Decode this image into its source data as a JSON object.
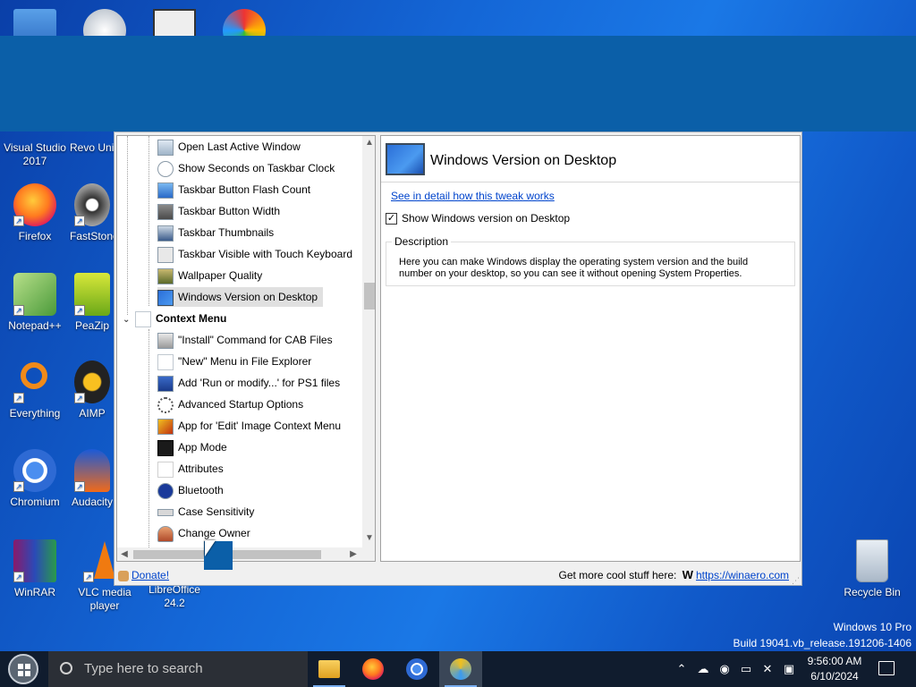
{
  "desktop": {
    "icons": [
      {
        "label": "Visual Studio 2017"
      },
      {
        "label": "Revo Uninstaller"
      },
      {
        "label": "Firefox"
      },
      {
        "label": "FastStone Image Viewer"
      },
      {
        "label": "Notepad++"
      },
      {
        "label": "PeaZip"
      },
      {
        "label": "Everything"
      },
      {
        "label": "AIMP"
      },
      {
        "label": "Chromium"
      },
      {
        "label": "Audacity"
      },
      {
        "label": "WinRAR"
      },
      {
        "label": "VLC media player"
      },
      {
        "label": "LibreOffice 24.2"
      },
      {
        "label": "Recycle Bin"
      }
    ],
    "watermark": {
      "edition": "Windows 10 Pro",
      "build": "Build 19041.vb_release.191206-1406"
    }
  },
  "app": {
    "tree": {
      "items": [
        {
          "label": "Open Last Active Window",
          "icon": "window-icon"
        },
        {
          "label": "Show Seconds on Taskbar Clock",
          "icon": "clock-icon"
        },
        {
          "label": "Taskbar Button Flash Count",
          "icon": "flash-icon"
        },
        {
          "label": "Taskbar Button Width",
          "icon": "button-width-icon"
        },
        {
          "label": "Taskbar Thumbnails",
          "icon": "thumbnails-icon"
        },
        {
          "label": "Taskbar Visible with Touch Keyboard",
          "icon": "keyboard-icon"
        },
        {
          "label": "Wallpaper Quality",
          "icon": "wallpaper-icon"
        },
        {
          "label": "Windows Version on Desktop",
          "icon": "desktop-icon",
          "selected": true
        }
      ],
      "group": {
        "label": "Context Menu",
        "icon": "context-menu-icon",
        "expanded": true
      },
      "group_items": [
        {
          "label": "\"Install\" Command for CAB Files",
          "icon": "cab-icon"
        },
        {
          "label": "\"New\" Menu in File Explorer",
          "icon": "new-menu-icon"
        },
        {
          "label": "Add 'Run or modify...' for PS1 files",
          "icon": "powershell-icon"
        },
        {
          "label": "Advanced Startup Options",
          "icon": "startup-icon"
        },
        {
          "label": "App for 'Edit' Image Context Menu",
          "icon": "image-edit-icon"
        },
        {
          "label": "App Mode",
          "icon": "app-mode-icon"
        },
        {
          "label": "Attributes",
          "icon": "attributes-icon"
        },
        {
          "label": "Bluetooth",
          "icon": "bluetooth-icon"
        },
        {
          "label": "Case Sensitivity",
          "icon": "case-icon"
        },
        {
          "label": "Change Owner",
          "icon": "owner-icon"
        }
      ]
    },
    "panel": {
      "title": "Windows Version on Desktop",
      "detail_link": "See in detail how this tweak works",
      "checkbox_label": "Show Windows version on Desktop",
      "checkbox_checked": true,
      "description_label": "Description",
      "description_text": "Here you can make Windows display the operating system version and the build number on your desktop, so you can see it without opening System Properties."
    },
    "status": {
      "donate": "Donate!",
      "more_text": "Get more cool stuff here:",
      "w_mark": "W",
      "site_link": "https://winaero.com"
    }
  },
  "taskbar": {
    "search_placeholder": "Type here to search",
    "time": "9:56:00 AM",
    "date": "6/10/2024"
  }
}
